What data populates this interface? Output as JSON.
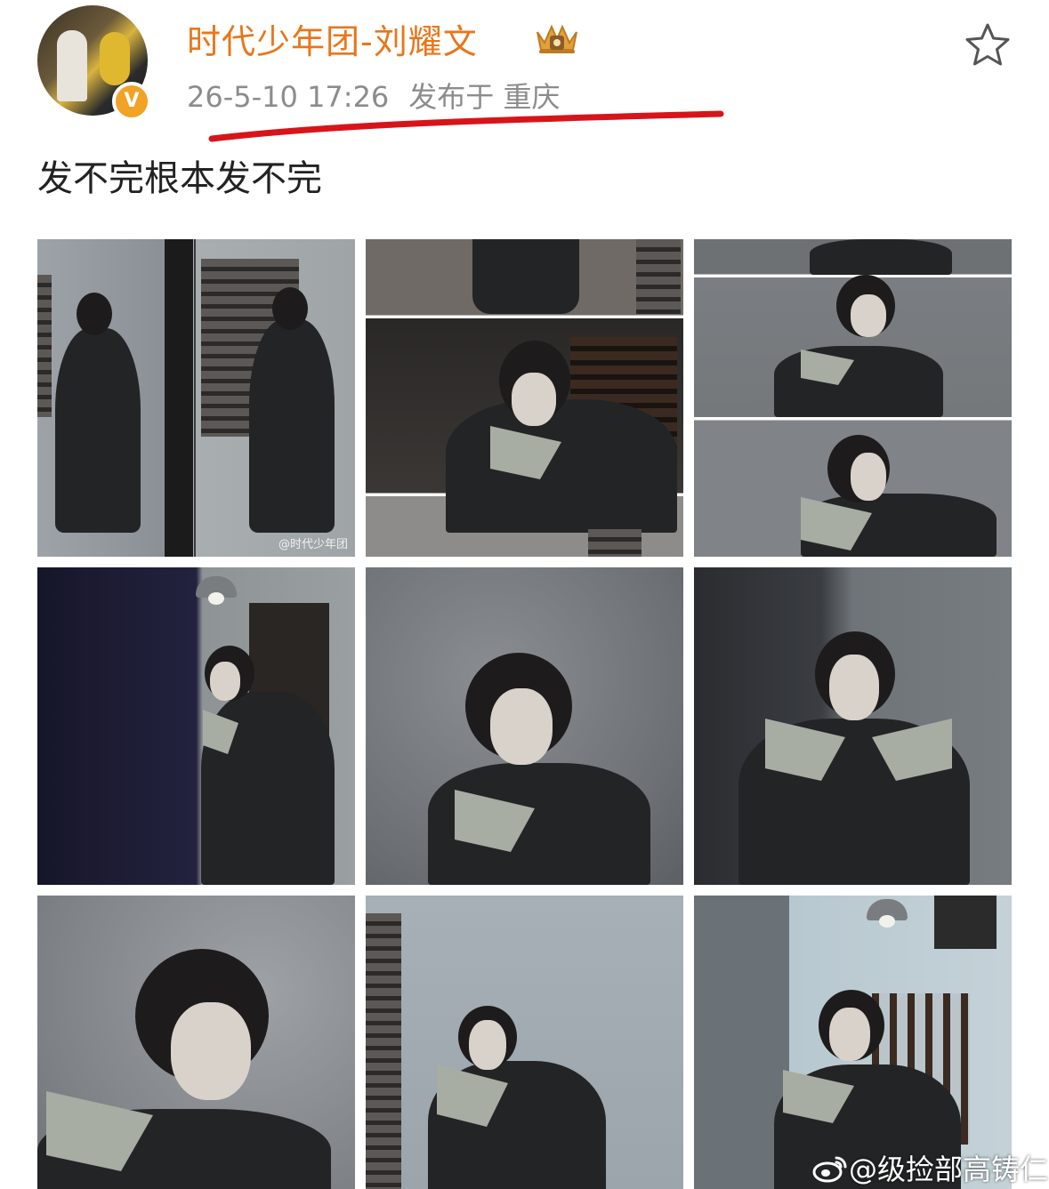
{
  "post": {
    "author": "时代少年团-刘耀文",
    "timestamp": "26-5-10 17:26",
    "location": "发布于 重庆",
    "verified_badge": "V",
    "text": "发不完根本发不完",
    "favorite_icon": "star-outline-icon",
    "crown_icon": "crown-member-icon"
  },
  "photos": [
    {
      "watermark": "@时代少年团"
    },
    {
      "watermark": ""
    },
    {
      "watermark": ""
    },
    {
      "watermark": ""
    },
    {
      "watermark": ""
    },
    {
      "watermark": ""
    },
    {
      "watermark": ""
    },
    {
      "watermark": ""
    },
    {
      "watermark": ""
    }
  ],
  "footer": {
    "watermark": "@级捡部高铸仁",
    "icon": "weibo-logo-icon"
  },
  "colors": {
    "author_name": "#e8761b",
    "meta_text": "#8c8c8c",
    "underline_mark": "#d8141b",
    "verified_badge": "#f1a325"
  }
}
